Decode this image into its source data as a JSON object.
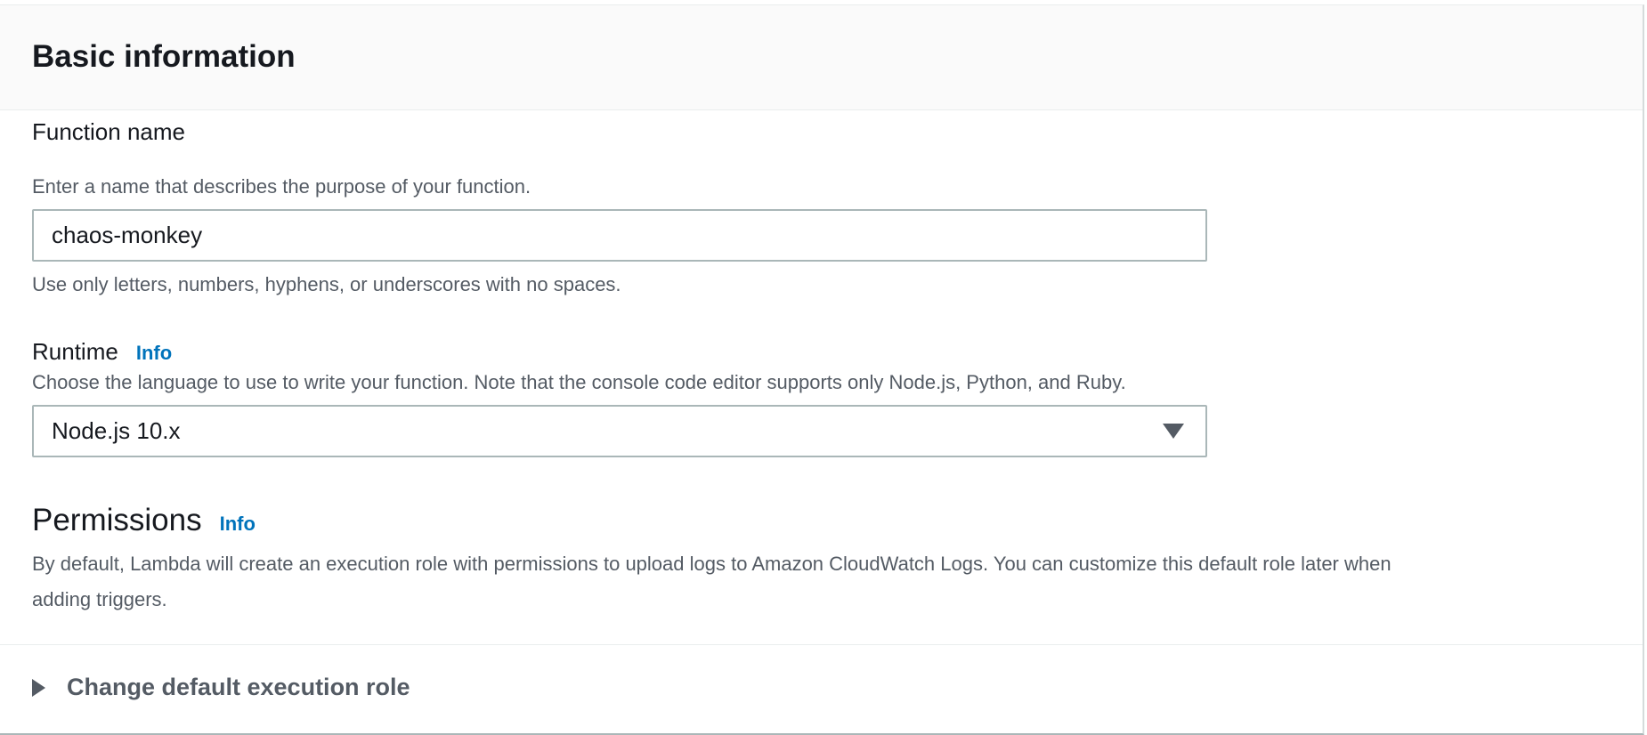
{
  "header": {
    "title": "Basic information"
  },
  "function_name": {
    "label": "Function name",
    "description": "Enter a name that describes the purpose of your function.",
    "value": "chaos-monkey",
    "hint": "Use only letters, numbers, hyphens, or underscores with no spaces."
  },
  "runtime": {
    "label": "Runtime",
    "info": "Info",
    "description": "Choose the language to use to write your function. Note that the console code editor supports only Node.js, Python, and Ruby.",
    "selected": "Node.js 10.x",
    "caret_icon": "caret-down-icon"
  },
  "permissions": {
    "title": "Permissions",
    "info": "Info",
    "description_line1": "By default, Lambda will create an execution role with permissions to upload logs to Amazon CloudWatch Logs. You can customize this default role later when",
    "description_line2": "adding triggers."
  },
  "expander": {
    "label": "Change default execution role",
    "icon": "caret-right-icon"
  },
  "colors": {
    "info_link": "#0073bb",
    "header_bg": "#fafafa",
    "text_primary": "#16191f",
    "text_secondary": "#545b64",
    "border": "#aab7b8"
  }
}
